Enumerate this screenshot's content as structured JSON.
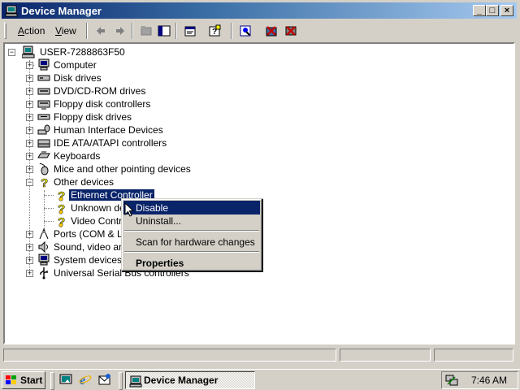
{
  "window": {
    "title": "Device Manager",
    "buttons": {
      "minimize": "_",
      "maximize": "□",
      "close": "×"
    }
  },
  "menubar": {
    "items": [
      {
        "label": "Action",
        "accel": "A",
        "rest": "ction"
      },
      {
        "label": "View",
        "accel": "V",
        "rest": "iew"
      }
    ]
  },
  "toolbar": {
    "icons": [
      "back-arrow-icon",
      "forward-arrow-icon",
      "up-folder-icon",
      "show-hide-tree-icon",
      "properties-icon",
      "help-icon",
      "scan-hardware-icon",
      "uninstall-icon",
      "disable-icon"
    ]
  },
  "tree": {
    "root": "USER-7288863F50",
    "categories": [
      "Computer",
      "Disk drives",
      "DVD/CD-ROM drives",
      "Floppy disk controllers",
      "Floppy disk drives",
      "Human Interface Devices",
      "IDE ATA/ATAPI controllers",
      "Keyboards",
      "Mice and other pointing devices",
      "Other devices"
    ],
    "other_devices": [
      "Ethernet Controller",
      "Unknown device",
      "Video Controller"
    ],
    "categories_after": [
      "Ports (COM & LPT)",
      "Sound, video and game controllers",
      "System devices",
      "Universal Serial Bus controllers"
    ]
  },
  "context_menu": {
    "disable": "Disable",
    "uninstall": "Uninstall...",
    "scan": "Scan for hardware changes",
    "properties": "Properties"
  },
  "taskbar": {
    "start": "Start",
    "task": "Device Manager",
    "clock": "7:46 AM",
    "quicklaunch": [
      "show-desktop-icon",
      "internet-explorer-icon",
      "outlook-express-icon"
    ]
  },
  "colors": {
    "selection": "#0a246a",
    "face": "#d4d0c8",
    "title_start": "#0a246a",
    "title_end": "#a6caf0"
  }
}
